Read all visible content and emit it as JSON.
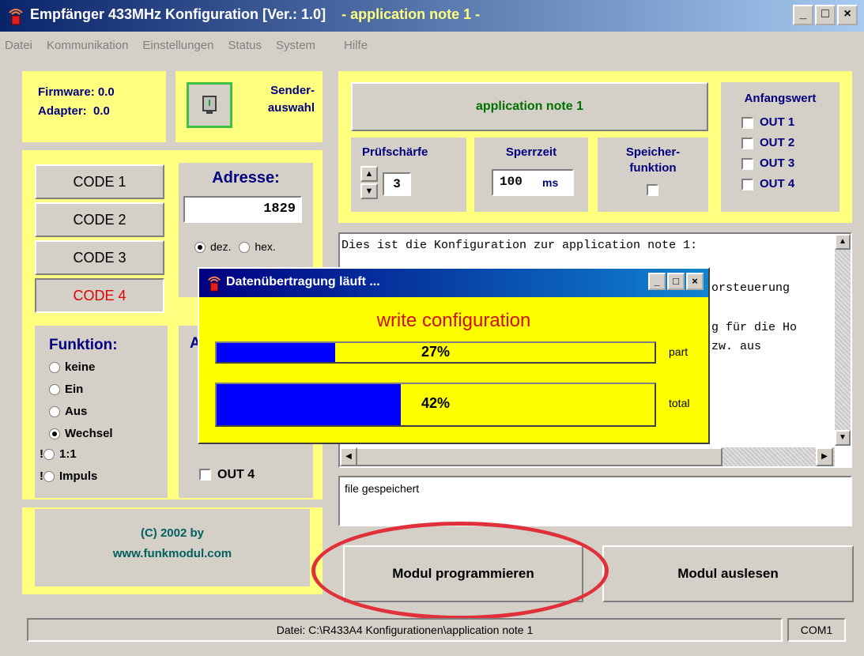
{
  "window": {
    "title": "Empfänger 433MHz Konfiguration  [Ver.: 1.0]",
    "subtitle": "- application note 1 -"
  },
  "menu": [
    "Datei",
    "Kommunikation",
    "Einstellungen",
    "Status",
    "System",
    "Hilfe"
  ],
  "info": {
    "firmware": "Firmware: 0.0",
    "adapter": "Adapter:  0.0"
  },
  "sender": {
    "label_line1": "Sender-",
    "label_line2": "auswahl"
  },
  "codes": [
    "CODE 1",
    "CODE 2",
    "CODE 3",
    "CODE 4"
  ],
  "adresse": {
    "label": "Adresse:",
    "value": "1829",
    "dez": "dez.",
    "hex": "hex."
  },
  "funktion": {
    "label": "Funktion:",
    "options": [
      "keine",
      "Ein",
      "Aus",
      "Wechsel",
      "1:1",
      "Impuls"
    ],
    "selected": "Wechsel",
    "warn_marks": [
      "!",
      "!"
    ]
  },
  "outputs_partial": {
    "out_label_hidden": "A",
    "out4": "OUT 4"
  },
  "copyright": {
    "line1": "(C)  2002 by",
    "line2": "www.funkmodul.com"
  },
  "config_name": "application note 1",
  "pruefschaerfe": {
    "label": "Prüfschärfe",
    "value": "3"
  },
  "sperrzeit": {
    "label": "Sperrzeit",
    "value": "100",
    "unit": "ms"
  },
  "speicher": {
    "label_line1": "Speicher-",
    "label_line2": "funktion"
  },
  "anfangswert": {
    "label": "Anfangswert",
    "outs": [
      "OUT 1",
      "OUT 2",
      "OUT 3",
      "OUT 4"
    ]
  },
  "description": {
    "line1": "Dies ist die Konfiguration zur application note 1:",
    "line2_tail": "orsteuerung",
    "line3_tail": "g für die Ho",
    "line4_tail": "zw. aus"
  },
  "log_text": "file gespeichert",
  "buttons": {
    "program": "Modul programmieren",
    "read": "Modul auslesen"
  },
  "statusbar": {
    "file": "Datei:  C:\\R433A4 Konfigurationen\\application note 1",
    "port": "COM1"
  },
  "dialog": {
    "title": "Datenübertragung läuft ...",
    "heading": "write configuration",
    "part": {
      "label": "part",
      "percent_text": "27%",
      "value": 0.27
    },
    "total": {
      "label": "total",
      "percent_text": "42%",
      "value": 0.42
    }
  },
  "colors": {
    "panel_yellow": "#ffff80",
    "dialog_yellow": "#ffff00",
    "progress_blue": "#0000ff",
    "highlight_red": "#e0303a"
  }
}
